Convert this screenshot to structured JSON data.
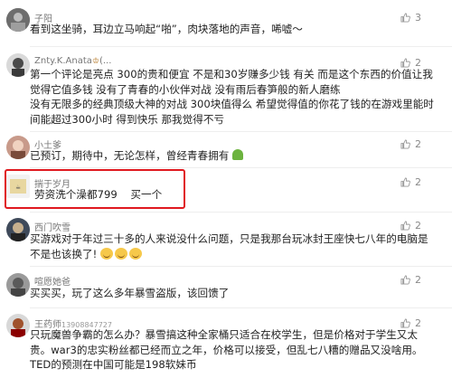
{
  "comments": [
    {
      "user": "子阳",
      "text": [
        "看到这坐骑，耳边立马响起“啪”，肉块落地的声音，唏嘘～"
      ],
      "likes": "3"
    },
    {
      "user": "Znty.K.Anata",
      "badge": "(...",
      "text": [
        "第一个评论是亮点 300的贵和便宜 不是和30岁赚多少钱 有关 而是这个东西的价值让我",
        "觉得它值多钱 没有了青春的小伙伴对战 没有雨后春笋般的新人磨练",
        "没有无限多的经典顶级大神的对战 300块值得么 希望觉得值的你花了钱的在游戏里能时",
        "间能超过300小时 得到快乐 那我觉得不亏"
      ],
      "likes": "2"
    },
    {
      "user": "小土爹",
      "text": [
        "已预订，期待中，无论怎样，曾经青春拥有"
      ],
      "likes": "2"
    },
    {
      "user": "揣于岁月",
      "text": [
        "劳资洗个澡都799    买一个"
      ],
      "likes": "2"
    },
    {
      "user": "西门吹雪",
      "text": [
        "买游戏对于年过三十多的人来说没什么问题，只是我那台玩冰封王座快七八年的电脑是",
        "不是也该换了!"
      ],
      "likes": "2"
    },
    {
      "user": "喧愿她爸",
      "text": [
        "买买买，玩了这么多年暴雪盗版，该回馈了"
      ],
      "likes": "2"
    },
    {
      "user": "王药师",
      "user_id": "13908847727",
      "text": [
        "只玩魔兽争霸的怎么办？暴雪搞这种全家桶只适合在校学生，但是价格对于学生又太",
        "贵。war3的忠实粉丝都已经而立之年，价格可以接受，但乱七八糟的赠品又没啥用。",
        "TED的预测在中国可能是198软妹币"
      ],
      "likes": "2"
    }
  ],
  "icons": {
    "like": "thumbs-up-icon"
  },
  "colors": {
    "highlight_border": "#e0191f",
    "username": "#777777",
    "vip": "#b87b2a"
  }
}
